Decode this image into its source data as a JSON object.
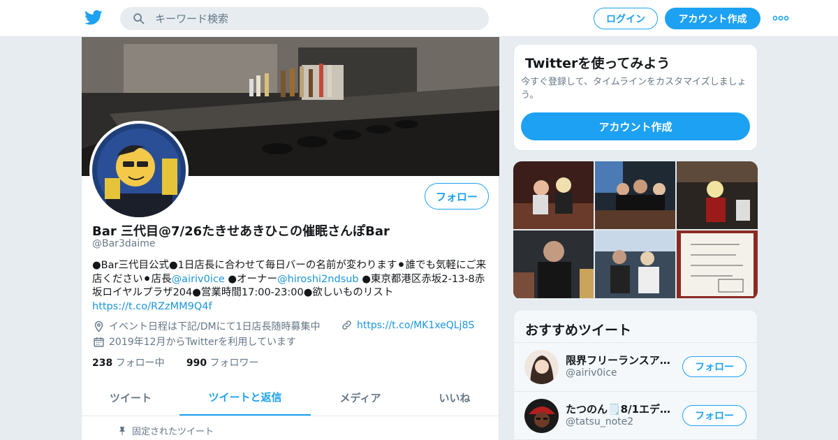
{
  "header": {
    "search_placeholder": "キーワード検索",
    "login_label": "ログイン",
    "signup_label": "アカウント作成"
  },
  "profile": {
    "name": "Bar 三代目@7/26たきせあきひこの催眠さんぽBar",
    "handle": "@Bar3daime",
    "follow_label": "フォロー",
    "bio": {
      "p1": "●Bar三代目公式●1日店長に合わせて毎日バーの名前が変わります⚫︎誰でも気軽にご来店ください⚫︎店長",
      "m1": "@airiv0ice",
      "p2": " ●オーナー",
      "m2": "@hiroshi2ndsub",
      "p3": " ●東京都港区赤坂2-13-8赤坂ロイヤルプラザ204●営業時間17:00-23:00●欲しいものリスト",
      "url": "https://t.co/RZzMM9Q4f"
    },
    "location": "イベント日程は下記/DMにて1日店長随時募集中",
    "website": "https://t.co/MK1xeQLj8S",
    "joined": "2019年12月からTwitterを利用しています",
    "following_count": "238",
    "following_label": "フォロー中",
    "followers_count": "990",
    "followers_label": "フォロワー",
    "tabs": [
      "ツイート",
      "ツイートと返信",
      "メディア",
      "いいね"
    ],
    "active_tab": "ツイートと返信",
    "pinned_label": "固定されたツイート"
  },
  "signup_card": {
    "title": "Twitterを使ってみよう",
    "text": "今すぐ登録して、タイムラインをカスタマイズしましょう。",
    "button": "アカウント作成"
  },
  "recommended": {
    "title": "おすすめツイート",
    "users": [
      {
        "name": "限界フリーランスア…",
        "handle": "@airiv0ice",
        "follow": "フォロー"
      },
      {
        "name": "たつのん🗒️8/1エデ…",
        "handle": "@tatsu_note2",
        "follow": "フォロー"
      }
    ]
  },
  "colors": {
    "accent": "#1da1f2",
    "background": "#e6ecf0",
    "muted_text": "#657786"
  }
}
